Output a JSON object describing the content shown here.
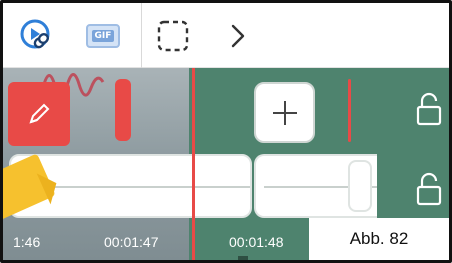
{
  "toolbar": {
    "buttons": [
      {
        "name": "video-link",
        "icon": "video-link-icon"
      },
      {
        "name": "gif",
        "icon": "gif-icon",
        "label": "GIF"
      },
      {
        "name": "select-region",
        "icon": "dashed-selection-icon"
      },
      {
        "name": "next",
        "icon": "chevron-right-icon"
      }
    ]
  },
  "timeline": {
    "add_button_icon": "plus-icon",
    "lock_icon": "lock-open-icon",
    "timestamps": [
      "1:46",
      "00:01:47",
      "00:01:48"
    ]
  },
  "caption": "Abb. 82",
  "colors": {
    "timeline_bg": "#4e836e",
    "accent_red": "#e84a47",
    "icon_blue": "#2f7fd8",
    "highlighter": "#f6c12e"
  }
}
